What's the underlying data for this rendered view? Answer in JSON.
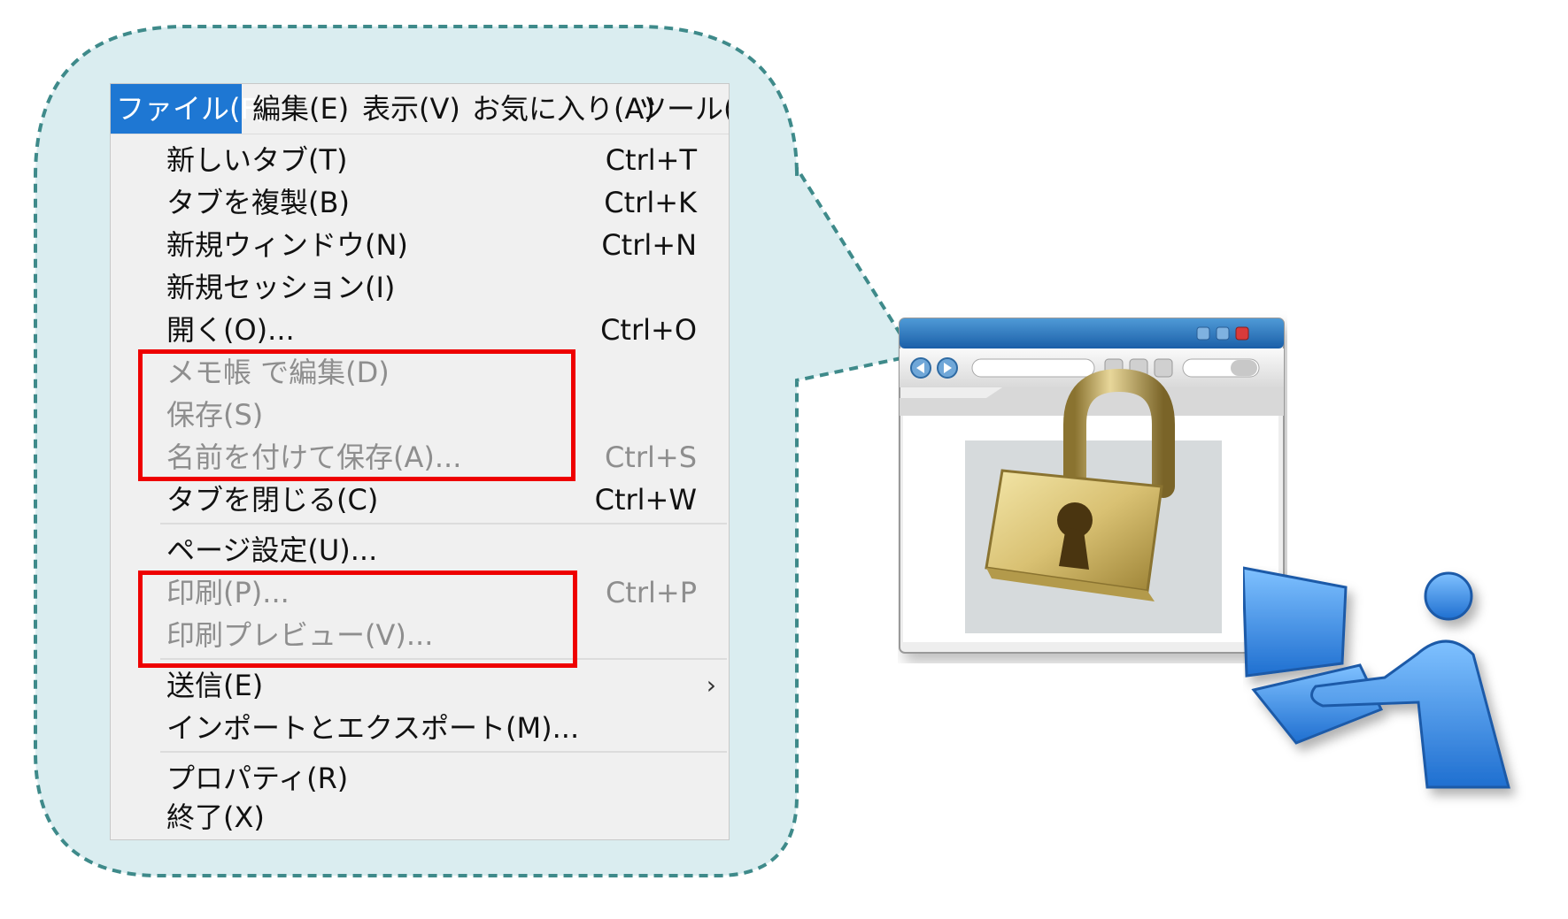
{
  "menubar": {
    "file": "ファイル(F)",
    "edit": "編集(E)",
    "view": "表示(V)",
    "favorites": "お気に入り(A)",
    "tools": "ツール(T)"
  },
  "file_menu": {
    "new_tab": {
      "label": "新しいタブ(T)",
      "shortcut": "Ctrl+T"
    },
    "duplicate_tab": {
      "label": "タブを複製(B)",
      "shortcut": "Ctrl+K"
    },
    "new_window": {
      "label": "新規ウィンドウ(N)",
      "shortcut": "Ctrl+N"
    },
    "new_session": {
      "label": "新規セッション(I)"
    },
    "open": {
      "label": "開く(O)...",
      "shortcut": "Ctrl+O"
    },
    "edit_notepad": {
      "label": "メモ帳 で編集(D)",
      "disabled": true
    },
    "save": {
      "label": "保存(S)",
      "disabled": true
    },
    "save_as": {
      "label": "名前を付けて保存(A)...",
      "shortcut": "Ctrl+S",
      "disabled": true
    },
    "close_tab": {
      "label": "タブを閉じる(C)",
      "shortcut": "Ctrl+W"
    },
    "page_setup": {
      "label": "ページ設定(U)..."
    },
    "print": {
      "label": "印刷(P)...",
      "shortcut": "Ctrl+P",
      "disabled": true
    },
    "print_preview": {
      "label": "印刷プレビュー(V)...",
      "disabled": true
    },
    "send": {
      "label": "送信(E)",
      "submenu_icon": "chevron-right-icon"
    },
    "import_export": {
      "label": "インポートとエクスポート(M)..."
    },
    "properties": {
      "label": "プロパティ(R)"
    },
    "exit": {
      "label": "終了(X)"
    }
  },
  "colors": {
    "bubble_fill": "#daedf0",
    "bubble_border": "#3e8a8a",
    "menu_highlight": "#1e77d3",
    "disabled_text": "#8e8e8e",
    "highlight_box": "#ee0000"
  },
  "icons": [
    "browser-window-icon",
    "padlock-icon",
    "computer-user-icon"
  ]
}
